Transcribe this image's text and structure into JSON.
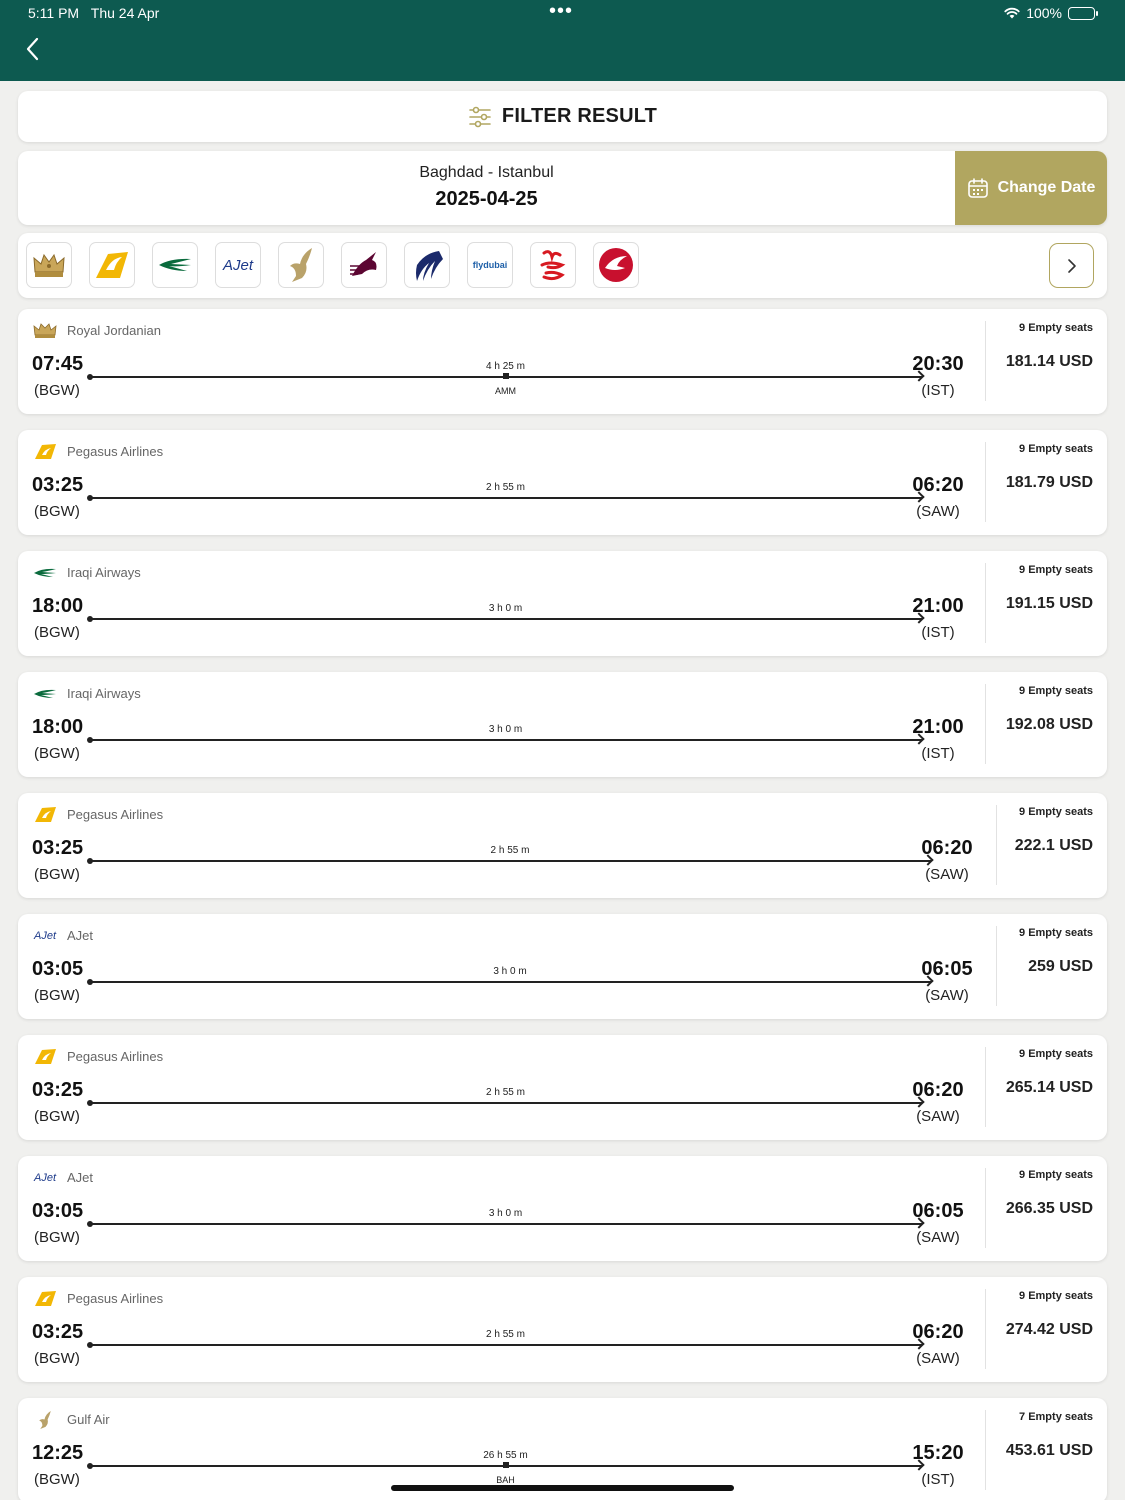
{
  "status_bar": {
    "time": "5:11 PM",
    "date": "Thu 24 Apr",
    "battery": "100%"
  },
  "filter": {
    "title": "FILTER RESULT"
  },
  "route": {
    "name": "Baghdad - Istanbul",
    "date": "2025-04-25",
    "change_date_label": "Change Date"
  },
  "airline_filter": {
    "logos": [
      "royal-jordanian-logo",
      "pegasus-logo",
      "iraqi-airways-logo",
      "ajet-logo",
      "gulf-air-logo",
      "qatar-airways-logo",
      "egyptair-logo",
      "flydubai-logo",
      "emirates-logo",
      "turkish-airlines-logo"
    ],
    "ajet_text": "AJet",
    "flydubai_text": "flydubai"
  },
  "flights": [
    {
      "airline": "Royal Jordanian",
      "logo": "royal-jordanian",
      "dep_time": "07:45",
      "dep_code": "(BGW)",
      "duration": "4 h 25 m",
      "via": "AMM",
      "arr_time": "20:30",
      "arr_code": "(IST)",
      "seats": "9 Empty seats",
      "price": "181.14 USD"
    },
    {
      "airline": "Pegasus Airlines",
      "logo": "pegasus",
      "dep_time": "03:25",
      "dep_code": "(BGW)",
      "duration": "2 h 55 m",
      "via": "",
      "arr_time": "06:20",
      "arr_code": "(SAW)",
      "seats": "9 Empty seats",
      "price": "181.79 USD"
    },
    {
      "airline": "Iraqi Airways",
      "logo": "iraqi",
      "dep_time": "18:00",
      "dep_code": "(BGW)",
      "duration": "3 h 0 m",
      "via": "",
      "arr_time": "21:00",
      "arr_code": "(IST)",
      "seats": "9 Empty seats",
      "price": "191.15 USD"
    },
    {
      "airline": "Iraqi Airways",
      "logo": "iraqi",
      "dep_time": "18:00",
      "dep_code": "(BGW)",
      "duration": "3 h 0 m",
      "via": "",
      "arr_time": "21:00",
      "arr_code": "(IST)",
      "seats": "9 Empty seats",
      "price": "192.08 USD"
    },
    {
      "airline": "Pegasus Airlines",
      "logo": "pegasus",
      "dep_time": "03:25",
      "dep_code": "(BGW)",
      "duration": "2 h 55 m",
      "via": "",
      "arr_time": "06:20",
      "arr_code": "(SAW)",
      "seats": "9 Empty seats",
      "price": "222.1 USD"
    },
    {
      "airline": "AJet",
      "logo": "ajet",
      "dep_time": "03:05",
      "dep_code": "(BGW)",
      "duration": "3 h 0 m",
      "via": "",
      "arr_time": "06:05",
      "arr_code": "(SAW)",
      "seats": "9 Empty seats",
      "price": "259 USD"
    },
    {
      "airline": "Pegasus Airlines",
      "logo": "pegasus",
      "dep_time": "03:25",
      "dep_code": "(BGW)",
      "duration": "2 h 55 m",
      "via": "",
      "arr_time": "06:20",
      "arr_code": "(SAW)",
      "seats": "9 Empty seats",
      "price": "265.14 USD"
    },
    {
      "airline": "AJet",
      "logo": "ajet",
      "dep_time": "03:05",
      "dep_code": "(BGW)",
      "duration": "3 h 0 m",
      "via": "",
      "arr_time": "06:05",
      "arr_code": "(SAW)",
      "seats": "9 Empty seats",
      "price": "266.35 USD"
    },
    {
      "airline": "Pegasus Airlines",
      "logo": "pegasus",
      "dep_time": "03:25",
      "dep_code": "(BGW)",
      "duration": "2 h 55 m",
      "via": "",
      "arr_time": "06:20",
      "arr_code": "(SAW)",
      "seats": "9 Empty seats",
      "price": "274.42 USD"
    },
    {
      "airline": "Gulf Air",
      "logo": "gulf-air",
      "dep_time": "12:25",
      "dep_code": "(BGW)",
      "duration": "26 h 55 m",
      "via": "BAH",
      "arr_time": "15:20",
      "arr_code": "(IST)",
      "seats": "7 Empty seats",
      "price": "453.61 USD"
    }
  ],
  "colors": {
    "header": "#0d5a50",
    "accent_gold": "#b1a660",
    "pegasus": "#f2b705",
    "iraqi": "#0a6b3d",
    "qatar": "#5c0632",
    "egyptair": "#1b2a6b",
    "emirates": "#d71921",
    "turkish": "#c8102e"
  }
}
